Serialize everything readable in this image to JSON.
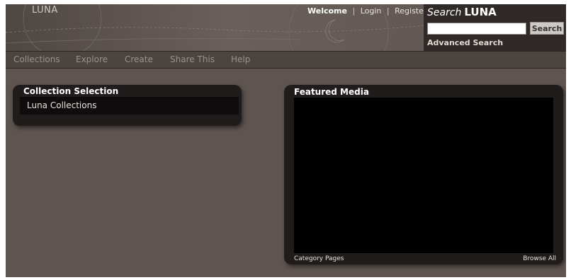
{
  "header": {
    "logo": "LUNA",
    "welcome": "Welcome",
    "login": "Login",
    "register": "Register",
    "separator": "|"
  },
  "search": {
    "title_prefix": "Search",
    "title_brand": "LUNA",
    "input_value": "",
    "button_label": "Search",
    "advanced_label": "Advanced Search"
  },
  "nav": {
    "items": [
      "Collections",
      "Explore",
      "Create",
      "Share This",
      "Help"
    ]
  },
  "collection_panel": {
    "title": "Collection Selection",
    "items": [
      "Luna Collections"
    ]
  },
  "featured_panel": {
    "title": "Featured Media",
    "category_link": "Category Pages",
    "browse_link": "Browse All"
  },
  "colors": {
    "background": "#5e5450",
    "panel": "#201c1b",
    "media": "#000000",
    "nav_text": "#9a918c"
  }
}
